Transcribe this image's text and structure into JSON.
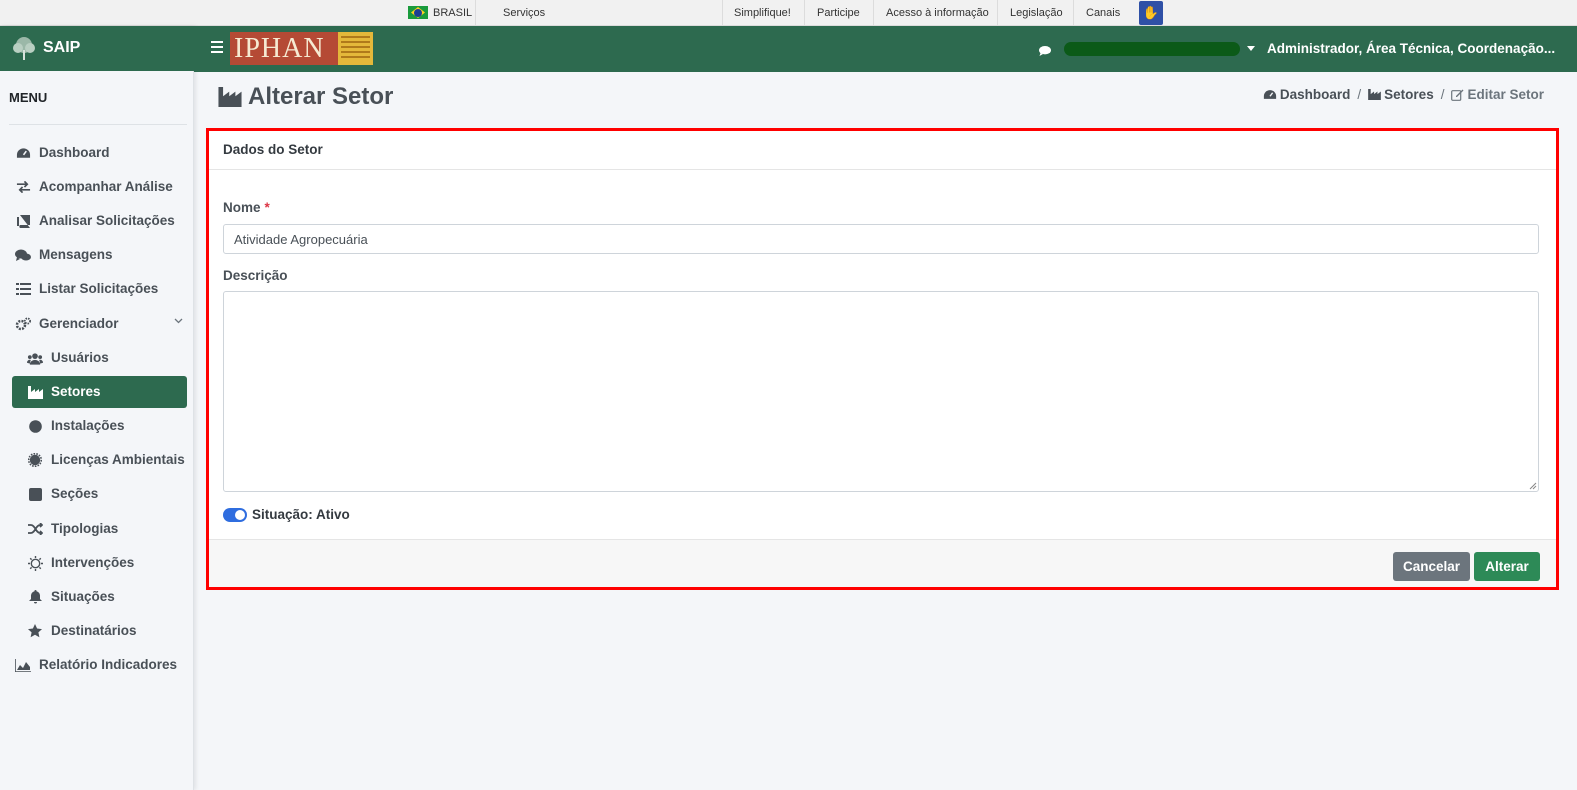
{
  "govbar": {
    "country": "BRASIL",
    "links": [
      "Serviços",
      "Simplifique!",
      "Participe",
      "Acesso à informação",
      "Legislação",
      "Canais"
    ]
  },
  "sidebar": {
    "brand": "SAIP",
    "menu_title": "MENU",
    "items": [
      {
        "label": "Dashboard",
        "icon": "tachometer-icon"
      },
      {
        "label": "Acompanhar Análise",
        "icon": "exchange-icon"
      },
      {
        "label": "Analisar Solicitações",
        "icon": "book-icon"
      },
      {
        "label": "Mensagens",
        "icon": "comments-icon"
      },
      {
        "label": "Listar Solicitações",
        "icon": "list-icon"
      },
      {
        "label": "Gerenciador",
        "icon": "cogs-icon"
      },
      {
        "label": "Usuários",
        "icon": "users-icon"
      },
      {
        "label": "Setores",
        "icon": "industry-icon",
        "active": true
      },
      {
        "label": "Instalações",
        "icon": "circle-icon"
      },
      {
        "label": "Licenças Ambientais",
        "icon": "certificate-icon"
      },
      {
        "label": "Seções",
        "icon": "square-icon"
      },
      {
        "label": "Tipologias",
        "icon": "random-icon"
      },
      {
        "label": "Intervenções",
        "icon": "sun-icon"
      },
      {
        "label": "Situações",
        "icon": "bell-icon"
      },
      {
        "label": "Destinatários",
        "icon": "star-icon"
      },
      {
        "label": "Relatório Indicadores",
        "icon": "area-chart-icon"
      }
    ]
  },
  "topbar": {
    "logo_text": "IPHAN",
    "user_role": "Administrador, Área Técnica, Coordenação..."
  },
  "page": {
    "title": "Alterar Setor",
    "breadcrumb": [
      "Dashboard",
      "Setores",
      "Editar Setor"
    ]
  },
  "form": {
    "card_title": "Dados do Setor",
    "nome_label": "Nome",
    "required_mark": "*",
    "nome_value": "Atividade Agropecuária",
    "descricao_label": "Descrição",
    "descricao_value": "",
    "situacao_label": "Situação: Ativo",
    "situacao_on": true,
    "cancel_label": "Cancelar",
    "save_label": "Alterar"
  },
  "colors": {
    "brand_green": "#2d6a4f",
    "highlight_border": "#ff0000",
    "switch_blue": "#2f6ddf",
    "save_button": "#2d8a57",
    "cancel_button": "#6c757d"
  }
}
